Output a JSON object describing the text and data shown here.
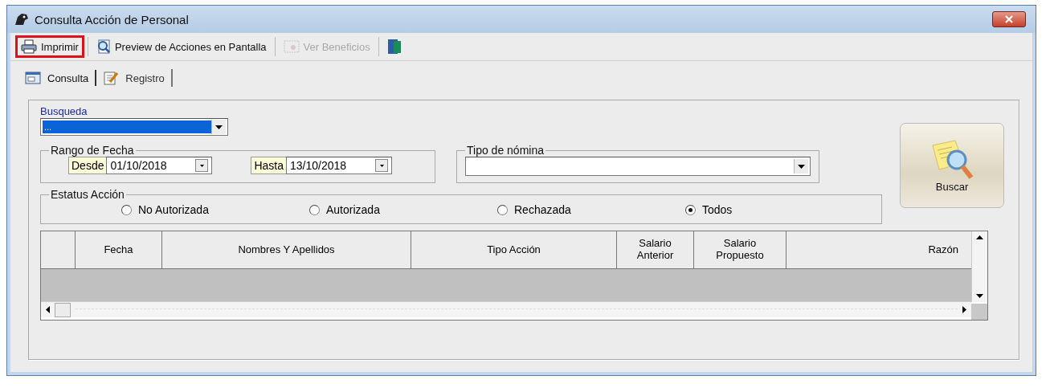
{
  "window": {
    "title": "Consulta Acción de Personal"
  },
  "toolbar": [
    {
      "kind": "print",
      "label": "Imprimir",
      "disabled": false,
      "highlighted": true
    },
    {
      "kind": "preview",
      "label": "Preview de Acciones en Pantalla",
      "disabled": false,
      "highlighted": false
    },
    {
      "kind": "benefits",
      "label": "Ver Beneficios",
      "disabled": true,
      "highlighted": false
    },
    {
      "kind": "exit",
      "disabled": false,
      "highlighted": false
    }
  ],
  "tabs": [
    {
      "label": "Consulta",
      "selected": true
    },
    {
      "label": "Registro",
      "selected": false
    }
  ],
  "busqueda": {
    "label": "Busqueda",
    "value": "..."
  },
  "date_range": {
    "title": "Rango de Fecha",
    "from_label": "Desde",
    "from_value": "01/10/2018",
    "to_label": "Hasta",
    "to_value": "13/10/2018"
  },
  "payroll_type": {
    "title": "Tipo de nómina"
  },
  "status": {
    "title": "Estatus Acción",
    "options": [
      {
        "label": "No Autorizada",
        "selected": false
      },
      {
        "label": "Autorizada",
        "selected": false
      },
      {
        "label": "Rechazada",
        "selected": false
      },
      {
        "label": "Todos",
        "selected": true
      }
    ]
  },
  "search_button": {
    "label": "Buscar"
  },
  "table": {
    "columns": [
      "Fecha",
      "Nombres Y Apellidos",
      "Tipo Acción",
      "Salario Anterior",
      "Salario Propuesto",
      "Razón"
    ]
  }
}
